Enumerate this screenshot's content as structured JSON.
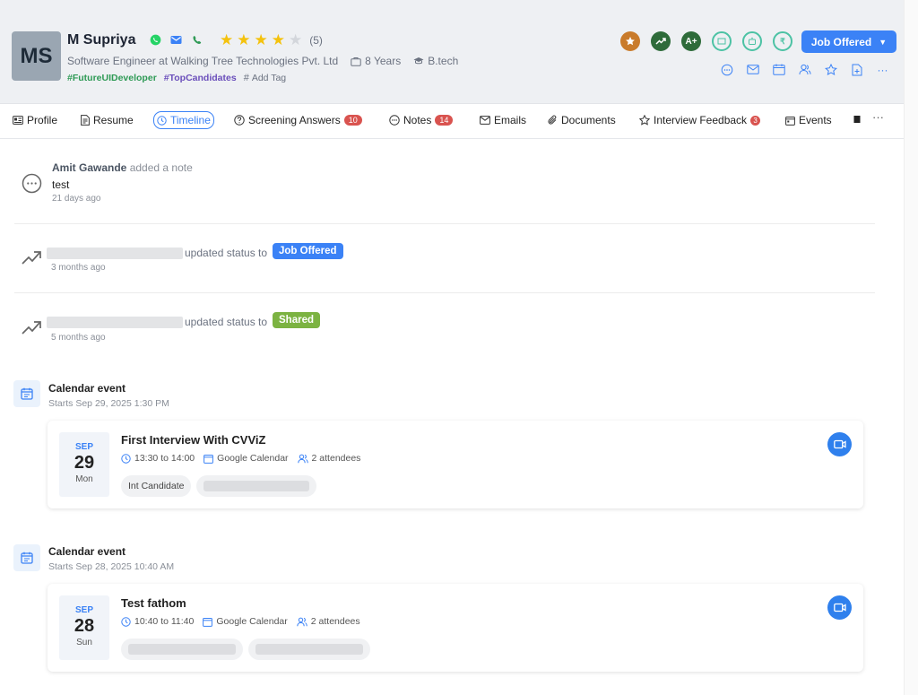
{
  "candidate": {
    "initials": "MS",
    "name": "M Supriya",
    "rating_count": "(5)",
    "rating": 4,
    "role": "Software Engineer at Walking Tree Technologies Pvt. Ltd",
    "experience": "8 Years",
    "education": "B.tech",
    "tags": [
      "#FutureUIDeveloper",
      "#TopCandidates"
    ],
    "add_tag_label": "Add Tag"
  },
  "status_button": {
    "label": "Job Offered"
  },
  "tabs": [
    {
      "label": "Profile",
      "icon": "profile-icon"
    },
    {
      "label": "Resume",
      "icon": "document-icon"
    },
    {
      "label": "Timeline",
      "icon": "clock-icon",
      "active": true
    },
    {
      "label": "Screening Answers",
      "icon": "question-icon",
      "count": "10"
    },
    {
      "label": "Notes",
      "icon": "chat-icon",
      "count": "14"
    },
    {
      "label": "Emails",
      "icon": "mail-icon"
    },
    {
      "label": "Documents",
      "icon": "paperclip-icon"
    },
    {
      "label": "Interview Feedback",
      "icon": "star-icon",
      "count": "3"
    },
    {
      "label": "Events",
      "icon": "calendar-icon"
    }
  ],
  "more_label": "···",
  "timeline": {
    "note": {
      "author": "Amit Gawande",
      "action": "added a note",
      "text": "test",
      "time": "21 days ago"
    },
    "status_updates": [
      {
        "action": "updated status to",
        "status": "Job Offered",
        "time": "3 months ago",
        "color": "#3b82f6"
      },
      {
        "action": "updated status to",
        "status": "Shared",
        "time": "5 months ago",
        "color": "#7cb342"
      }
    ],
    "events": [
      {
        "heading": "Calendar event",
        "starts": "Starts Sep 29, 2025 1:30 PM",
        "month": "SEP",
        "day": "29",
        "weekday": "Mon",
        "title": "First Interview With CVViZ",
        "time": "13:30 to 14:00",
        "calendar": "Google Calendar",
        "attendees": "2 attendees",
        "chip": "Int Candidate"
      },
      {
        "heading": "Calendar event",
        "starts": "Starts Sep 28, 2025 10:40 AM",
        "month": "SEP",
        "day": "28",
        "weekday": "Sun",
        "title": "Test fathom",
        "time": "10:40 to 11:40",
        "calendar": "Google Calendar",
        "attendees": "2 attendees"
      }
    ]
  }
}
